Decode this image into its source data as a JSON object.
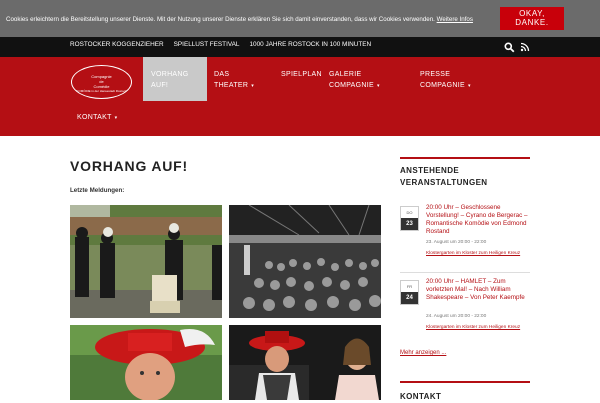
{
  "cookie": {
    "text": "Cookies erleichtern die Bereitstellung unserer Dienste. Mit der Nutzung unserer Dienste erklären Sie sich damit einverstanden, dass wir Cookies verwenden.",
    "link": "Weitere Infos",
    "button_line1": "OKAY,",
    "button_line2": "DANKE."
  },
  "topbar": {
    "links": [
      "ROSTOCKER KOGGENZIEHER",
      "SPIELLUST FESTIVAL",
      "1000 JAHRE ROSTOCK IN 100 MINUTEN"
    ],
    "icons": [
      "search-icon",
      "rss-icon"
    ]
  },
  "logo": {
    "line1": "Compagnie",
    "line2": "de",
    "line3": "Comédie",
    "tagline": "KOMÖDIE in der Hansestadt Rostock"
  },
  "nav": {
    "vorhang_1": "VORHANG",
    "vorhang_2": "AUF!",
    "theater_1": "DAS",
    "theater_2": "THEATER",
    "spielplan": "SPIELPLAN",
    "galerie_1": "GALERIE",
    "galerie_2": "COMPAGNIE",
    "presse_1": "PRESSE",
    "presse_2": "COMPAGNIE",
    "kontakt": "KONTAKT"
  },
  "main": {
    "title": "VORHANG AUF!",
    "news_label": "Letzte Meldungen:"
  },
  "sidebar": {
    "events_title_1": "ANSTEHENDE",
    "events_title_2": "VERANSTALTUNGEN",
    "events": [
      {
        "day": "DO",
        "date": "23",
        "title": "20:00 Uhr – Geschlossene Vorstellung! – Cyrano de Bergerac – Romantische Komödie von Edmond Rostand",
        "time": "23. August um 20:00 - 22:00",
        "venue": "Klostergarten im Kloster zum Heiligen Kreuz"
      },
      {
        "day": "FR",
        "date": "24",
        "title": "20:00 Uhr – HAMLET – Zum vorletzten Mal! – Nach William Shakespeare – Von Peter Kaempfe",
        "time": "24. August um 20:00 - 22:00",
        "venue": "Klostergarten im Kloster zum Heiligen Kreuz"
      }
    ],
    "more_link": "Mehr anzeigen ...",
    "contact_title": "KONTAKT"
  },
  "colors": {
    "brand_red": "#b40f14",
    "active_nav": "#c9c9c9",
    "topbar": "#111111",
    "cookie_bar": "#6b6b6b"
  }
}
